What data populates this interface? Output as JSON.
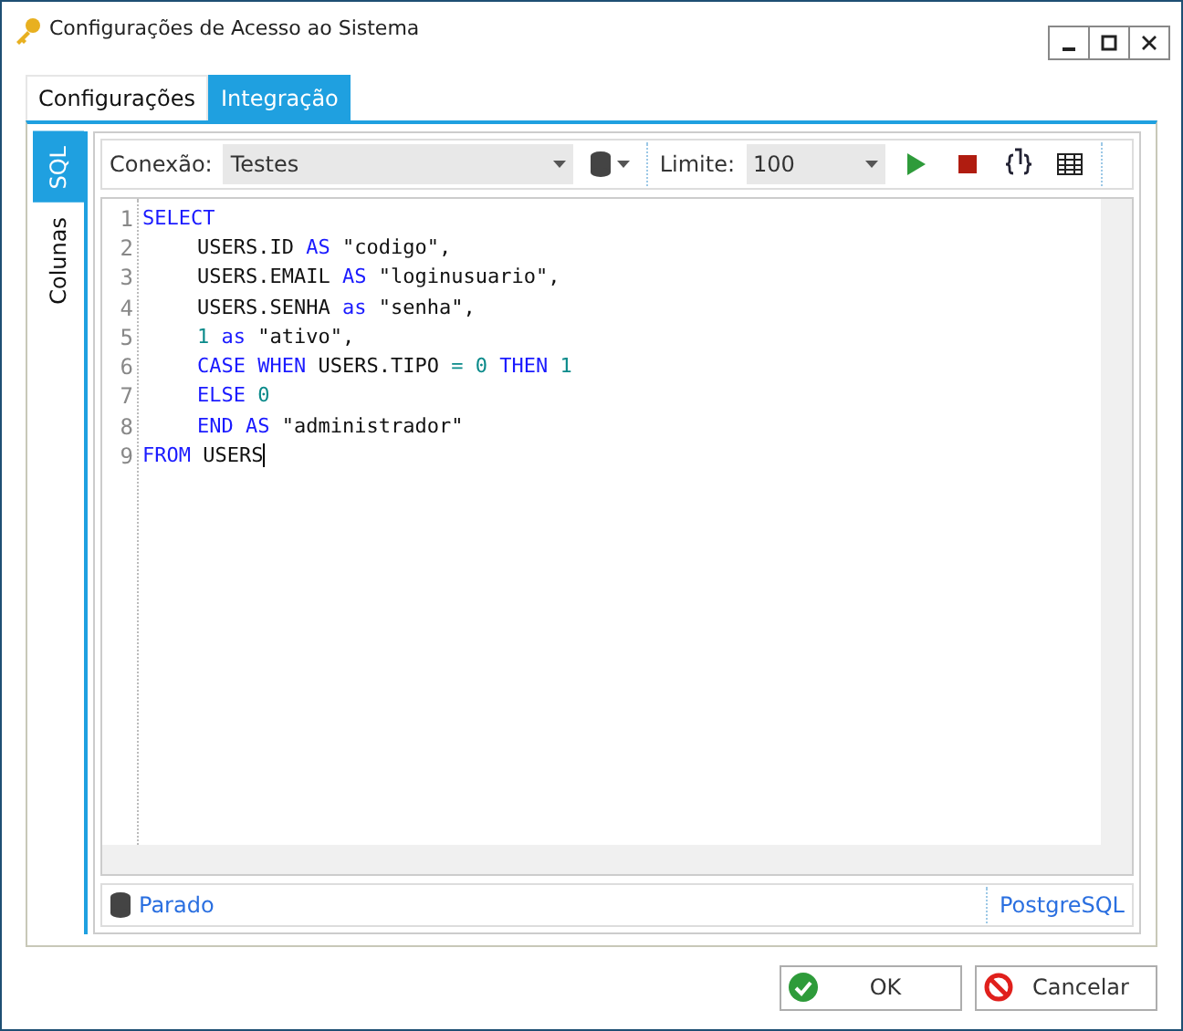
{
  "window": {
    "title": "Configurações de Acesso ao Sistema"
  },
  "tabs": [
    {
      "label": "Configurações",
      "selected": false
    },
    {
      "label": "Integração",
      "selected": true
    }
  ],
  "side_tabs": [
    {
      "label": "SQL",
      "selected": true
    },
    {
      "label": "Colunas",
      "selected": false
    }
  ],
  "toolbar": {
    "connection_label": "Conexão:",
    "connection": "Testes",
    "limit_label": "Limite:",
    "limit": "100"
  },
  "editor": {
    "lines": [
      {
        "number": "1",
        "indent": false,
        "tokens": [
          {
            "kind": "keyword",
            "text": "SELECT"
          }
        ]
      },
      {
        "number": "2",
        "indent": true,
        "tokens": [
          {
            "kind": "plain",
            "text": "USERS.ID "
          },
          {
            "kind": "keyword",
            "text": "AS"
          },
          {
            "kind": "plain",
            "text": " \"codigo\","
          }
        ]
      },
      {
        "number": "3",
        "indent": true,
        "tokens": [
          {
            "kind": "plain",
            "text": "USERS.EMAIL "
          },
          {
            "kind": "keyword",
            "text": "AS"
          },
          {
            "kind": "plain",
            "text": " \"loginusuario\","
          }
        ]
      },
      {
        "number": "4",
        "indent": true,
        "tokens": [
          {
            "kind": "plain",
            "text": "USERS.SENHA "
          },
          {
            "kind": "keyword",
            "text": "as"
          },
          {
            "kind": "plain",
            "text": " \"senha\","
          }
        ]
      },
      {
        "number": "5",
        "indent": true,
        "tokens": [
          {
            "kind": "number",
            "text": "1"
          },
          {
            "kind": "keyword",
            "text": " as"
          },
          {
            "kind": "plain",
            "text": " \"ativo\","
          }
        ]
      },
      {
        "number": "6",
        "indent": true,
        "tokens": [
          {
            "kind": "keyword",
            "text": "CASE WHEN"
          },
          {
            "kind": "plain",
            "text": " USERS.TIPO "
          },
          {
            "kind": "number",
            "text": "= 0"
          },
          {
            "kind": "keyword",
            "text": " THEN"
          },
          {
            "kind": "number",
            "text": " 1"
          }
        ]
      },
      {
        "number": "7",
        "indent": true,
        "tokens": [
          {
            "kind": "keyword",
            "text": "ELSE"
          },
          {
            "kind": "number",
            "text": " 0"
          }
        ]
      },
      {
        "number": "8",
        "indent": true,
        "tokens": [
          {
            "kind": "keyword",
            "text": "END AS"
          },
          {
            "kind": "plain",
            "text": " \"administrador\""
          }
        ]
      },
      {
        "number": "9",
        "indent": false,
        "tokens": [
          {
            "kind": "keyword",
            "text": "FROM"
          },
          {
            "kind": "plain",
            "text": " USERS"
          }
        ]
      }
    ]
  },
  "status": {
    "state": "Parado",
    "database": "PostgreSQL"
  },
  "buttons": [
    {
      "kind": "ok",
      "label": "OK"
    },
    {
      "kind": "cancel",
      "label": "Cancelar"
    }
  ]
}
